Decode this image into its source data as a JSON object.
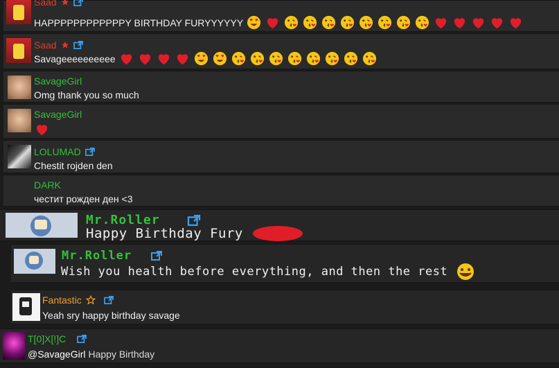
{
  "colors": {
    "name_red": "#e03a2e",
    "name_green": "#35c13a",
    "name_orange": "#f2a027",
    "link_blue": "#3a9ff0"
  },
  "messages": [
    {
      "user": "Saad",
      "text": "HAPPPPPPPPPPPPY BIRTHDAY FURYYYYYY",
      "emojis": [
        "heart-eyes-emoji",
        "heart-emoji",
        "kiss-emoji",
        "kiss-emoji",
        "kiss-emoji",
        "kiss-emoji",
        "kiss-emoji",
        "kiss-emoji",
        "kiss-emoji",
        "kiss-emoji",
        "heart-emoji",
        "heart-emoji",
        "heart-emoji",
        "heart-emoji",
        "heart-emoji"
      ]
    },
    {
      "user": "Saad",
      "text": "Savageeeeeeeeee",
      "emojis": [
        "heart-emoji",
        "heart-emoji",
        "heart-emoji",
        "heart-emoji",
        "heart-eyes-emoji",
        "heart-eyes-emoji",
        "kiss-emoji",
        "kiss-emoji",
        "kiss-emoji",
        "kiss-emoji",
        "kiss-emoji",
        "kiss-emoji",
        "kiss-emoji",
        "kiss-emoji"
      ]
    },
    {
      "user": "SavageGirl",
      "text": "Omg thank you so much"
    },
    {
      "user": "SavageGirl",
      "text": "",
      "emojis": [
        "heart-emoji"
      ]
    },
    {
      "user": "LOLUMAD",
      "text": "Chestit rojden den"
    },
    {
      "user": "DARK",
      "text": "честит рожден ден <3"
    },
    {
      "user": "Mr.Roller",
      "text": "Happy Birthday Fury"
    },
    {
      "user": "Mr.Roller",
      "text": "Wish you health before everything, and then the rest"
    },
    {
      "user": "Fantastic",
      "text": "Yeah sry happy birthday savage"
    },
    {
      "user": "T[0]X[!]C",
      "mention": "@SavageGirl",
      "text": "Happy Birthday"
    }
  ]
}
